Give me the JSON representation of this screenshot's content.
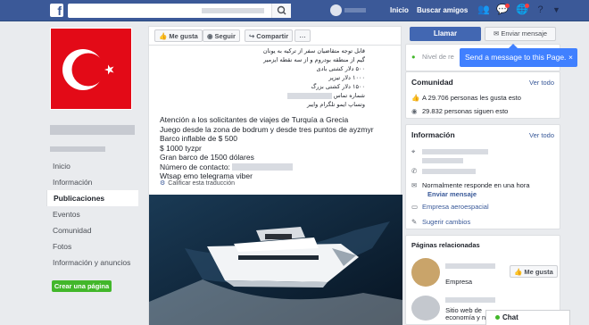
{
  "topbar": {
    "logo": "f",
    "nav_home": "Inicio",
    "nav_find_friends": "Buscar amigos"
  },
  "left": {
    "nav": [
      "Inicio",
      "Información",
      "Publicaciones",
      "Eventos",
      "Comunidad",
      "Fotos",
      "Información y anuncios"
    ],
    "active_index": 2,
    "create_page": "Crear una página"
  },
  "actions": {
    "like": "Me gusta",
    "follow": "Seguir",
    "share": "Compartir",
    "more": "..."
  },
  "post": {
    "arabic_lines": [
      "قابل توجه متقاضیان سفر از ترکیه به یونان",
      "گیم از منطقه بودروم و از سه نقطه ایزمیر",
      "۵۰۰ دلار کشتی بادی",
      "۱۰۰۰ دلار تیزپر",
      "۱۵۰۰ دلار کشتی بزرگ",
      "شماره تماس",
      "وتساپ ایمو تلگرام وایبر"
    ],
    "lines": [
      "Atención a los solicitantes de viajes de Turquía a Grecia",
      "Juego desde la zona de bodrum y desde tres puntos de ayzmyr",
      "Barco inflable de $ 500",
      "$ 1000 tyzpr",
      "Gran barco de 1500 dólares",
      "Número de contacto:",
      "Wtsap emo telegrama viber"
    ],
    "rate_translation": "Calificar esta traducción"
  },
  "right": {
    "call": "Llamar",
    "send_message": "Enviar mensaje",
    "tooltip": "Send a message to this Page.",
    "tooltip_close": "×",
    "response_level": "Nivel de re",
    "community": {
      "title": "Comunidad",
      "see_all": "Ver todo",
      "likes": "A 29.706 personas les gusta esto",
      "follows": "29.832 personas siguen esto"
    },
    "info": {
      "title": "Información",
      "see_all": "Ver todo",
      "response": "Normalmente responde en una hora",
      "send_message": "Enviar mensaje",
      "category": "Empresa aeroespacial",
      "suggest": "Sugerir cambios"
    },
    "related": {
      "title": "Páginas relacionadas",
      "item1_type": "Empresa",
      "like": "Me gusta",
      "item2_type": "Sitio web de economía y neg"
    }
  },
  "chat": {
    "label": "Chat"
  }
}
